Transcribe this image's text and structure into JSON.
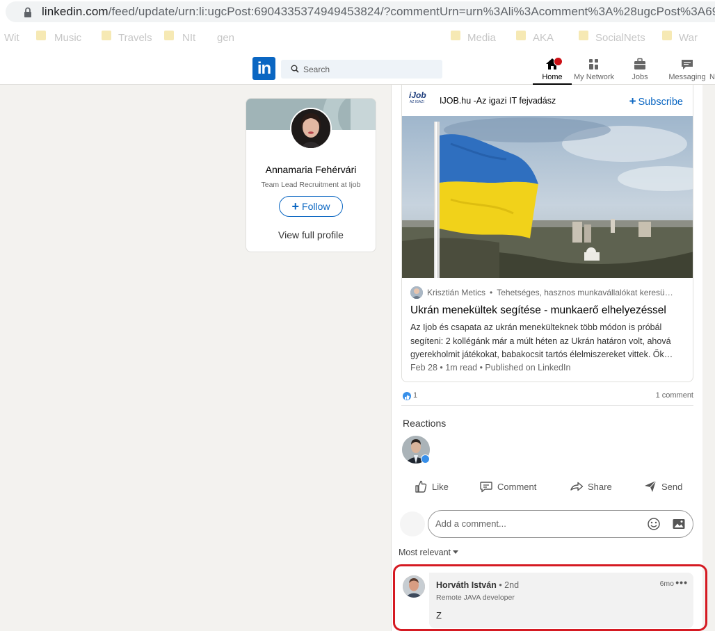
{
  "browser": {
    "url_host": "linkedin.com",
    "url_rest": "/feed/update/urn:li:ugcPost:6904335374949453824/?commentUrn=urn%3Ali%3Acomment%3A%28ugcPost%3A69",
    "bookmarks": [
      "Wit",
      "Music",
      "Travels",
      "NIt",
      "gen",
      "Media",
      "AKA",
      "SocialNets",
      "War"
    ]
  },
  "header": {
    "logo_text": "in",
    "search_placeholder": "Search",
    "nav": [
      {
        "label": "Home",
        "icon": "home-icon",
        "active": true
      },
      {
        "label": "My Network",
        "icon": "network-icon"
      },
      {
        "label": "Jobs",
        "icon": "briefcase-icon"
      },
      {
        "label": "Messaging",
        "icon": "messaging-icon"
      },
      {
        "label": "N",
        "icon": "bell-icon"
      }
    ]
  },
  "profile": {
    "name": "Annamaria Fehérvári",
    "headline": "Team Lead Recruitment at Ijob",
    "follow_label": "Follow",
    "view_profile_label": "View full profile"
  },
  "post": {
    "page_name": "IJOB.hu -Az igazi IT fejvadász",
    "subscribe_label": "Subscribe",
    "article": {
      "author": "Krisztián Metics",
      "author_headline": "Tehetséges, hasznos munkavállalókat keresü…",
      "title": "Ukrán menekültek segítése - munkaerő elhelyezéssel",
      "body": "Az Ijob és csapata az ukrán menekülteknek több módon is próbál segíteni: 2 kollégánk már a múlt héten az Ukrán határon volt, ahová gyerekholmit játékokat, babakocsit tartós élelmiszereket vittek. Ők…",
      "date": "Feb 28 • 1m read • Published on LinkedIn"
    },
    "like_count": "1",
    "comment_count": "1 comment",
    "reactions_label": "Reactions",
    "actions": {
      "like": "Like",
      "comment": "Comment",
      "share": "Share",
      "send": "Send"
    },
    "comment_placeholder": "Add a comment...",
    "sort_label": "Most relevant"
  },
  "comment": {
    "author": "Horváth István",
    "degree": "• 2nd",
    "headline": "Remote JAVA developer",
    "time": "6mo",
    "text": "Z"
  },
  "colors": {
    "brand": "#0a66c2",
    "highlight": "#d51a22",
    "notification": "#cc1016"
  }
}
